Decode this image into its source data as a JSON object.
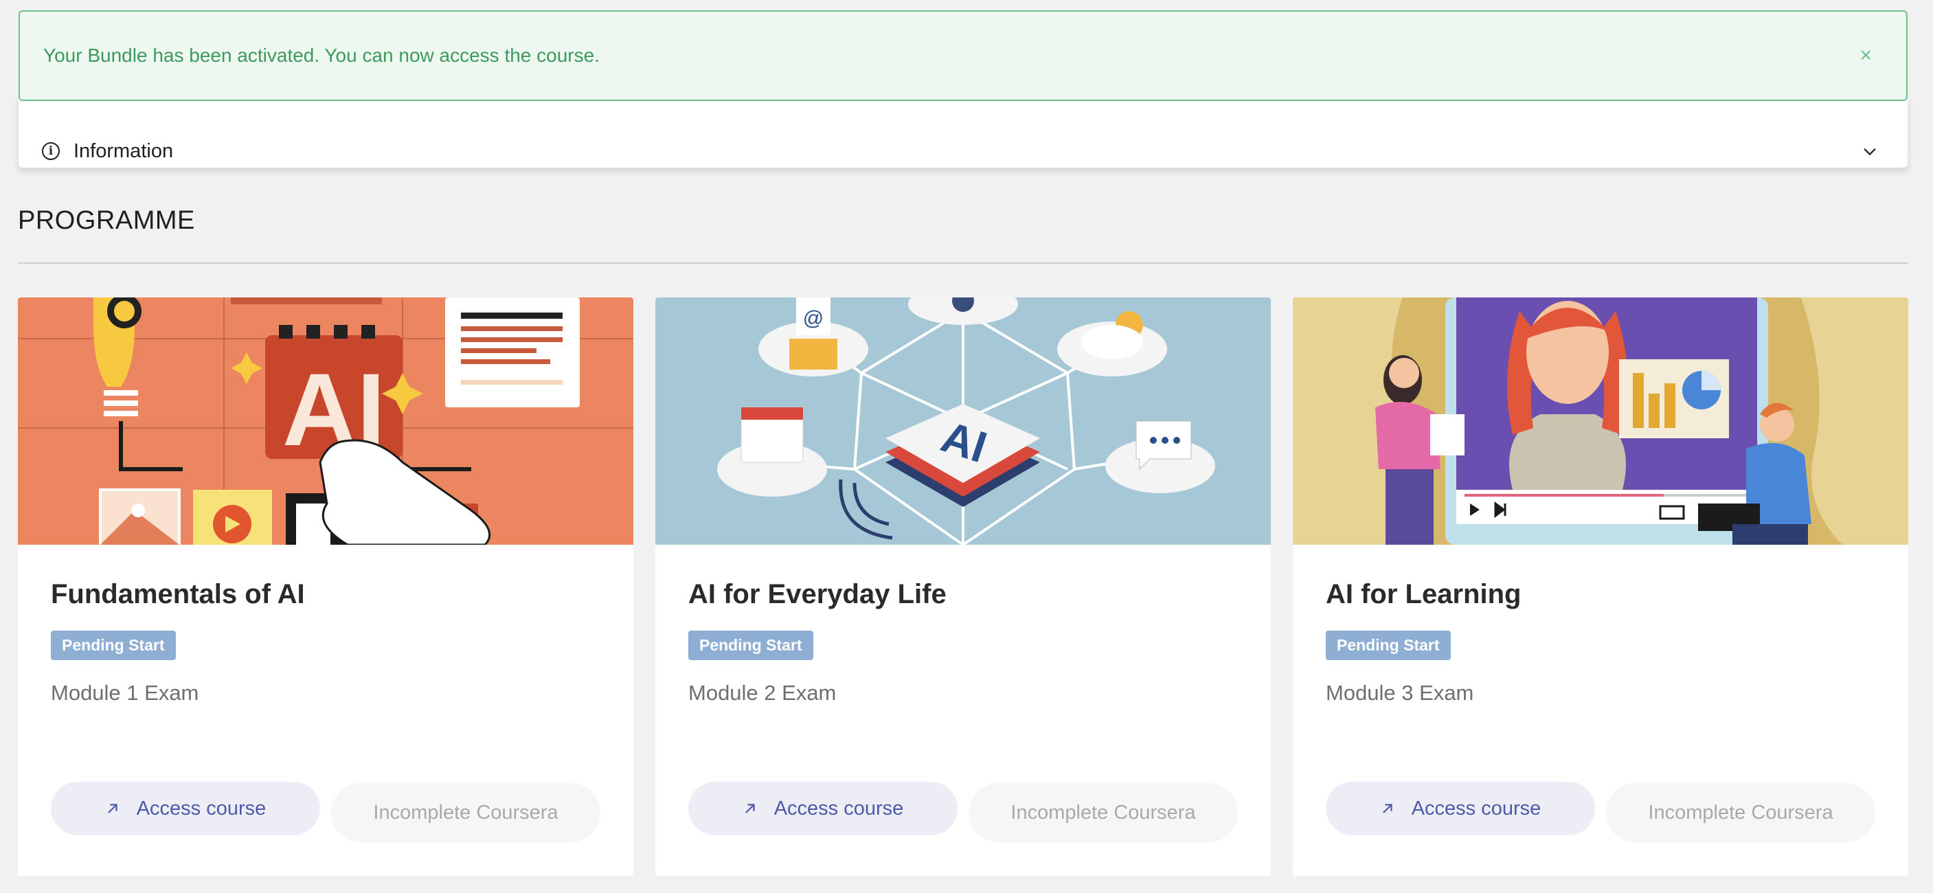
{
  "alert": {
    "message": "Your Bundle has been activated. You can now access the course.",
    "close": "×"
  },
  "info": {
    "label": "Information",
    "icon": "info-icon"
  },
  "section": {
    "title": "PROGRAMME"
  },
  "colors": {
    "badge": "#8eaed3",
    "accent": "#4e5aa8",
    "success": "#3d9a5f"
  },
  "cards": [
    {
      "title": "Fundamentals of AI",
      "badge": "Pending Start",
      "module": "Module 1 Exam",
      "access_label": "Access course",
      "status_label": "Incomplete Coursera",
      "image_text": "AI"
    },
    {
      "title": "AI for Everyday Life",
      "badge": "Pending Start",
      "module": "Module 2 Exam",
      "access_label": "Access course",
      "status_label": "Incomplete Coursera",
      "image_text": "AI"
    },
    {
      "title": "AI for Learning",
      "badge": "Pending Start",
      "module": "Module 3 Exam",
      "access_label": "Access course",
      "status_label": "Incomplete Coursera"
    }
  ]
}
